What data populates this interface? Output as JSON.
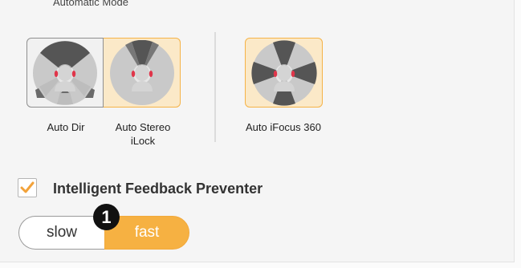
{
  "section": {
    "title": "Automatic Mode"
  },
  "modes": [
    {
      "id": "auto-dir",
      "label": "Auto Dir",
      "selected": true
    },
    {
      "id": "auto-stereo-ilock",
      "label_line1": "Auto Stereo",
      "label_line2": "iLock",
      "selected": false
    },
    {
      "id": "auto-ifocus-360",
      "label": "Auto iFocus 360",
      "selected": false
    }
  ],
  "feedback": {
    "label": "Intelligent Feedback Preventer",
    "checked": true
  },
  "speed": {
    "slow_label": "slow",
    "fast_label": "fast",
    "selected": "fast"
  },
  "callout": {
    "number": "1"
  },
  "colors": {
    "accent": "#f6b142",
    "accent_light": "#fbe9c8",
    "ear_red": "#e0354a",
    "sector_dark": "#555555"
  },
  "icons": {
    "auto_dir": "head-with-directional-beams-icon",
    "auto_stereo": "head-with-stereo-cone-icon",
    "auto_ifocus": "head-with-360-sectors-icon",
    "check": "checkmark-icon"
  }
}
